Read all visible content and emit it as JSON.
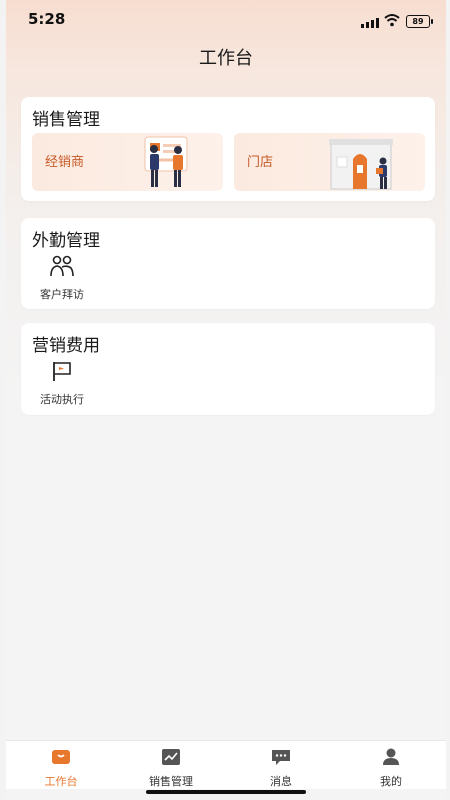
{
  "status_bar": {
    "time": "5:28",
    "battery": "89"
  },
  "page": {
    "title": "工作台"
  },
  "sections": {
    "sales": {
      "title": "销售管理",
      "tiles": [
        {
          "label": "经销商"
        },
        {
          "label": "门店"
        }
      ]
    },
    "field": {
      "title": "外勤管理",
      "items": [
        {
          "label": "客户拜访",
          "icon": "people-icon"
        }
      ]
    },
    "marketing": {
      "title": "营销费用",
      "items": [
        {
          "label": "活动执行",
          "icon": "flag-icon"
        }
      ]
    }
  },
  "tabbar": {
    "active": 0,
    "accent": "#e8772e",
    "items": [
      {
        "label": "工作台",
        "icon": "workbench-icon"
      },
      {
        "label": "销售管理",
        "icon": "chart-icon"
      },
      {
        "label": "消息",
        "icon": "message-icon"
      },
      {
        "label": "我的",
        "icon": "profile-icon"
      }
    ]
  }
}
